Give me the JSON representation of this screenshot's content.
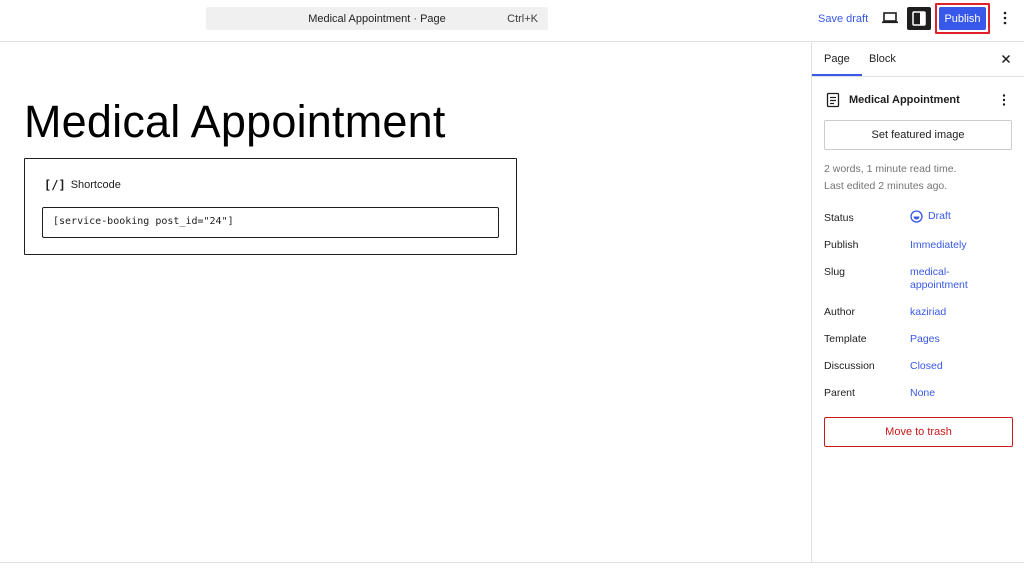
{
  "topbar": {
    "doc_title": "Medical Appointment · Page",
    "shortcut": "Ctrl+K",
    "save_draft": "Save draft",
    "publish": "Publish",
    "accent": "#3858e9"
  },
  "editor": {
    "title": "Medical Appointment",
    "shortcode_block": {
      "icon": "[/]",
      "label": "Shortcode",
      "value": "[service-booking post_id=\"24\"]"
    }
  },
  "sidebar": {
    "tabs": [
      {
        "label": "Page",
        "active": true
      },
      {
        "label": "Block",
        "active": false
      }
    ],
    "document": {
      "title": "Medical Appointment",
      "icon": "page-icon"
    },
    "featured_image": "Set featured image",
    "meta": {
      "words": "2 words, 1 minute read time.",
      "edited": "Last edited 2 minutes ago."
    },
    "rows": [
      {
        "label": "Status",
        "value": "Draft"
      },
      {
        "label": "Publish",
        "value": "Immediately"
      },
      {
        "label": "Slug",
        "value": "medical-appointment"
      },
      {
        "label": "Author",
        "value": "kaziriad"
      },
      {
        "label": "Template",
        "value": "Pages"
      },
      {
        "label": "Discussion",
        "value": "Closed"
      },
      {
        "label": "Parent",
        "value": "None"
      }
    ],
    "trash": "Move to trash",
    "danger_color": "#cc1818"
  }
}
